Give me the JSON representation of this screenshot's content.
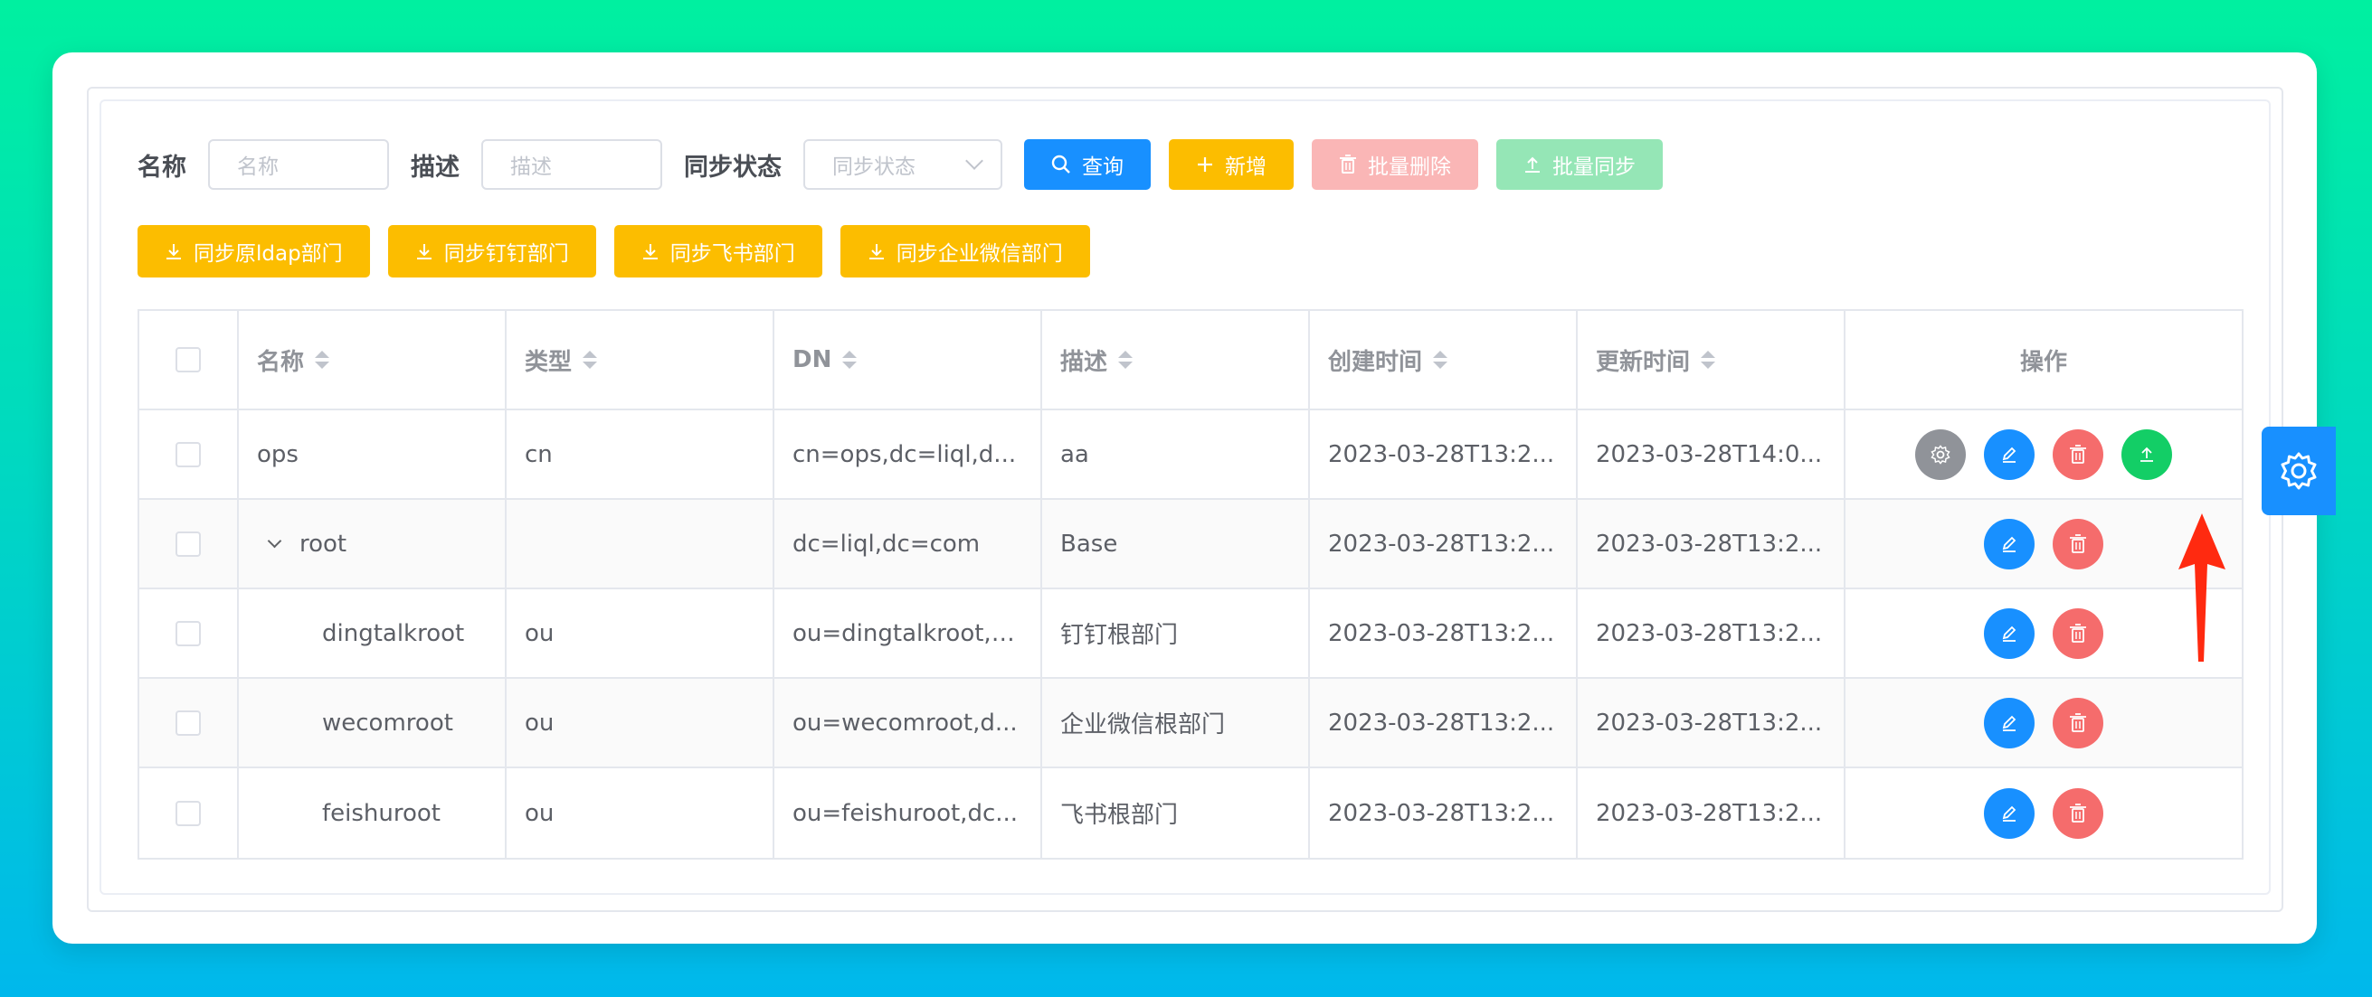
{
  "filters": {
    "name_label": "名称",
    "name_placeholder": "名称",
    "desc_label": "描述",
    "desc_placeholder": "描述",
    "status_label": "同步状态",
    "status_placeholder": "同步状态"
  },
  "toolbar": {
    "query": "查询",
    "add": "新增",
    "batch_delete": "批量删除",
    "batch_sync": "批量同步",
    "sync_ldap": "同步原ldap部门",
    "sync_dingtalk": "同步钉钉部门",
    "sync_feishu": "同步飞书部门",
    "sync_wecom": "同步企业微信部门"
  },
  "table": {
    "headers": [
      "名称",
      "类型",
      "DN",
      "描述",
      "创建时间",
      "更新时间",
      "操作"
    ],
    "rows": [
      {
        "name": "ops",
        "type": "cn",
        "dn": "cn=ops,dc=liql,d...",
        "desc": "aa",
        "created": "2023-03-28T13:2...",
        "updated": "2023-03-28T14:0..."
      },
      {
        "name": "root",
        "type": "",
        "dn": "dc=liql,dc=com",
        "desc": "Base",
        "created": "2023-03-28T13:2...",
        "updated": "2023-03-28T13:2..."
      },
      {
        "name": "dingtalkroot",
        "type": "ou",
        "dn": "ou=dingtalkroot,d...",
        "desc": "钉钉根部门",
        "created": "2023-03-28T13:2...",
        "updated": "2023-03-28T13:2..."
      },
      {
        "name": "wecomroot",
        "type": "ou",
        "dn": "ou=wecomroot,d...",
        "desc": "企业微信根部门",
        "created": "2023-03-28T13:2...",
        "updated": "2023-03-28T13:2..."
      },
      {
        "name": "feishuroot",
        "type": "ou",
        "dn": "ou=feishuroot,dc...",
        "desc": "飞书根部门",
        "created": "2023-03-28T13:2...",
        "updated": "2023-03-28T13:2..."
      }
    ]
  },
  "colors": {
    "primary": "#1890ff",
    "warning": "#fcbd00",
    "danger": "#f56c6c",
    "success": "#13ce66",
    "annotation_arrow": "#ff2a10"
  },
  "icons": [
    "search-icon",
    "plus-icon",
    "trash-icon",
    "upload-icon",
    "download-icon",
    "gear-icon",
    "edit-icon",
    "chevron-down-icon",
    "sort-icon"
  ]
}
